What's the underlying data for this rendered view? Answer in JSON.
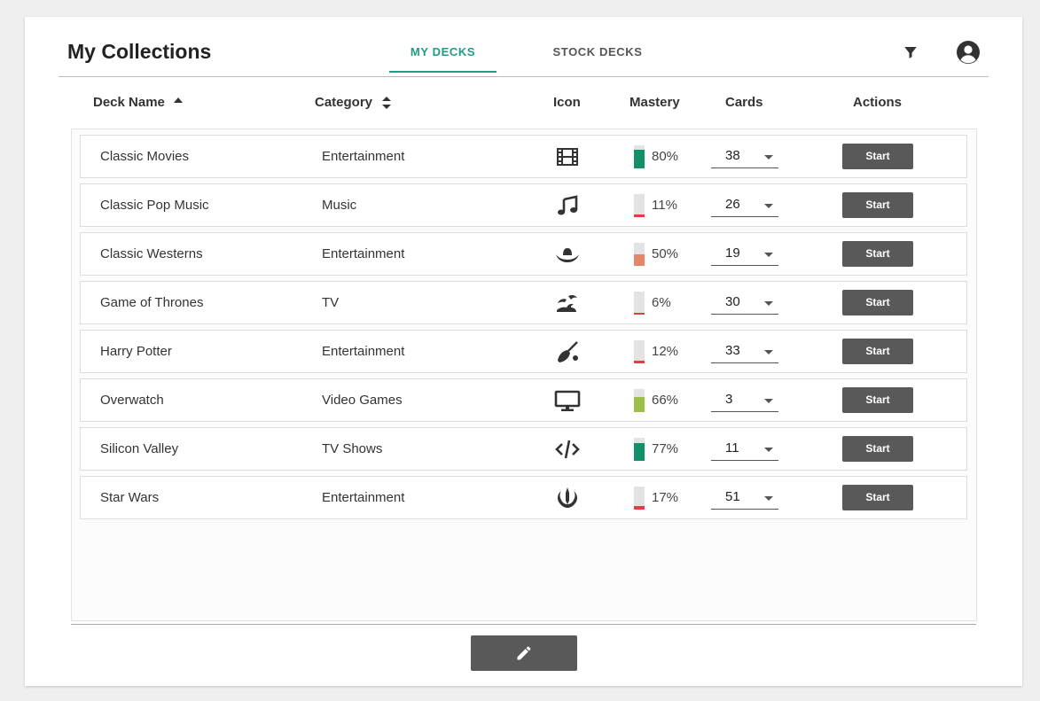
{
  "header": {
    "title": "My Collections",
    "tabs": [
      {
        "label": "MY DECKS",
        "active": true
      },
      {
        "label": "STOCK DECKS",
        "active": false
      }
    ],
    "icons": {
      "filter": "filter-icon",
      "account": "account-circle-icon"
    }
  },
  "table": {
    "columns": {
      "name": "Deck Name",
      "category": "Category",
      "icon": "Icon",
      "mastery": "Mastery",
      "cards": "Cards",
      "actions": "Actions"
    },
    "sort": {
      "column": "name",
      "direction": "ascending"
    },
    "action_label": "Start",
    "rows": [
      {
        "name": "Classic Movies",
        "category": "Entertainment",
        "icon": "film-icon",
        "mastery": 80,
        "mastery_label": "80%",
        "mastery_color": "#12906a",
        "cards": "38"
      },
      {
        "name": "Classic Pop Music",
        "category": "Music",
        "icon": "music-note-icon",
        "mastery": 11,
        "mastery_label": "11%",
        "mastery_color": "#e04040",
        "cards": "26"
      },
      {
        "name": "Classic Westerns",
        "category": "Entertainment",
        "icon": "cowboy-hat-icon",
        "mastery": 50,
        "mastery_label": "50%",
        "mastery_color": "#e8846a",
        "cards": "19"
      },
      {
        "name": "Game of Thrones",
        "category": "TV",
        "icon": "dragon-icon",
        "mastery": 6,
        "mastery_label": "6%",
        "mastery_color": "#e04040",
        "cards": "30"
      },
      {
        "name": "Harry Potter",
        "category": "Entertainment",
        "icon": "broom-icon",
        "mastery": 12,
        "mastery_label": "12%",
        "mastery_color": "#e04040",
        "cards": "33"
      },
      {
        "name": "Overwatch",
        "category": "Video Games",
        "icon": "desktop-icon",
        "mastery": 66,
        "mastery_label": "66%",
        "mastery_color": "#9bc04a",
        "cards": "3"
      },
      {
        "name": "Silicon Valley",
        "category": "TV Shows",
        "icon": "code-icon",
        "mastery": 77,
        "mastery_label": "77%",
        "mastery_color": "#12906a",
        "cards": "11"
      },
      {
        "name": "Star Wars",
        "category": "Entertainment",
        "icon": "jedi-order-icon",
        "mastery": 17,
        "mastery_label": "17%",
        "mastery_color": "#e04040",
        "cards": "51"
      }
    ]
  },
  "footer": {
    "edit_icon": "pencil-icon"
  }
}
